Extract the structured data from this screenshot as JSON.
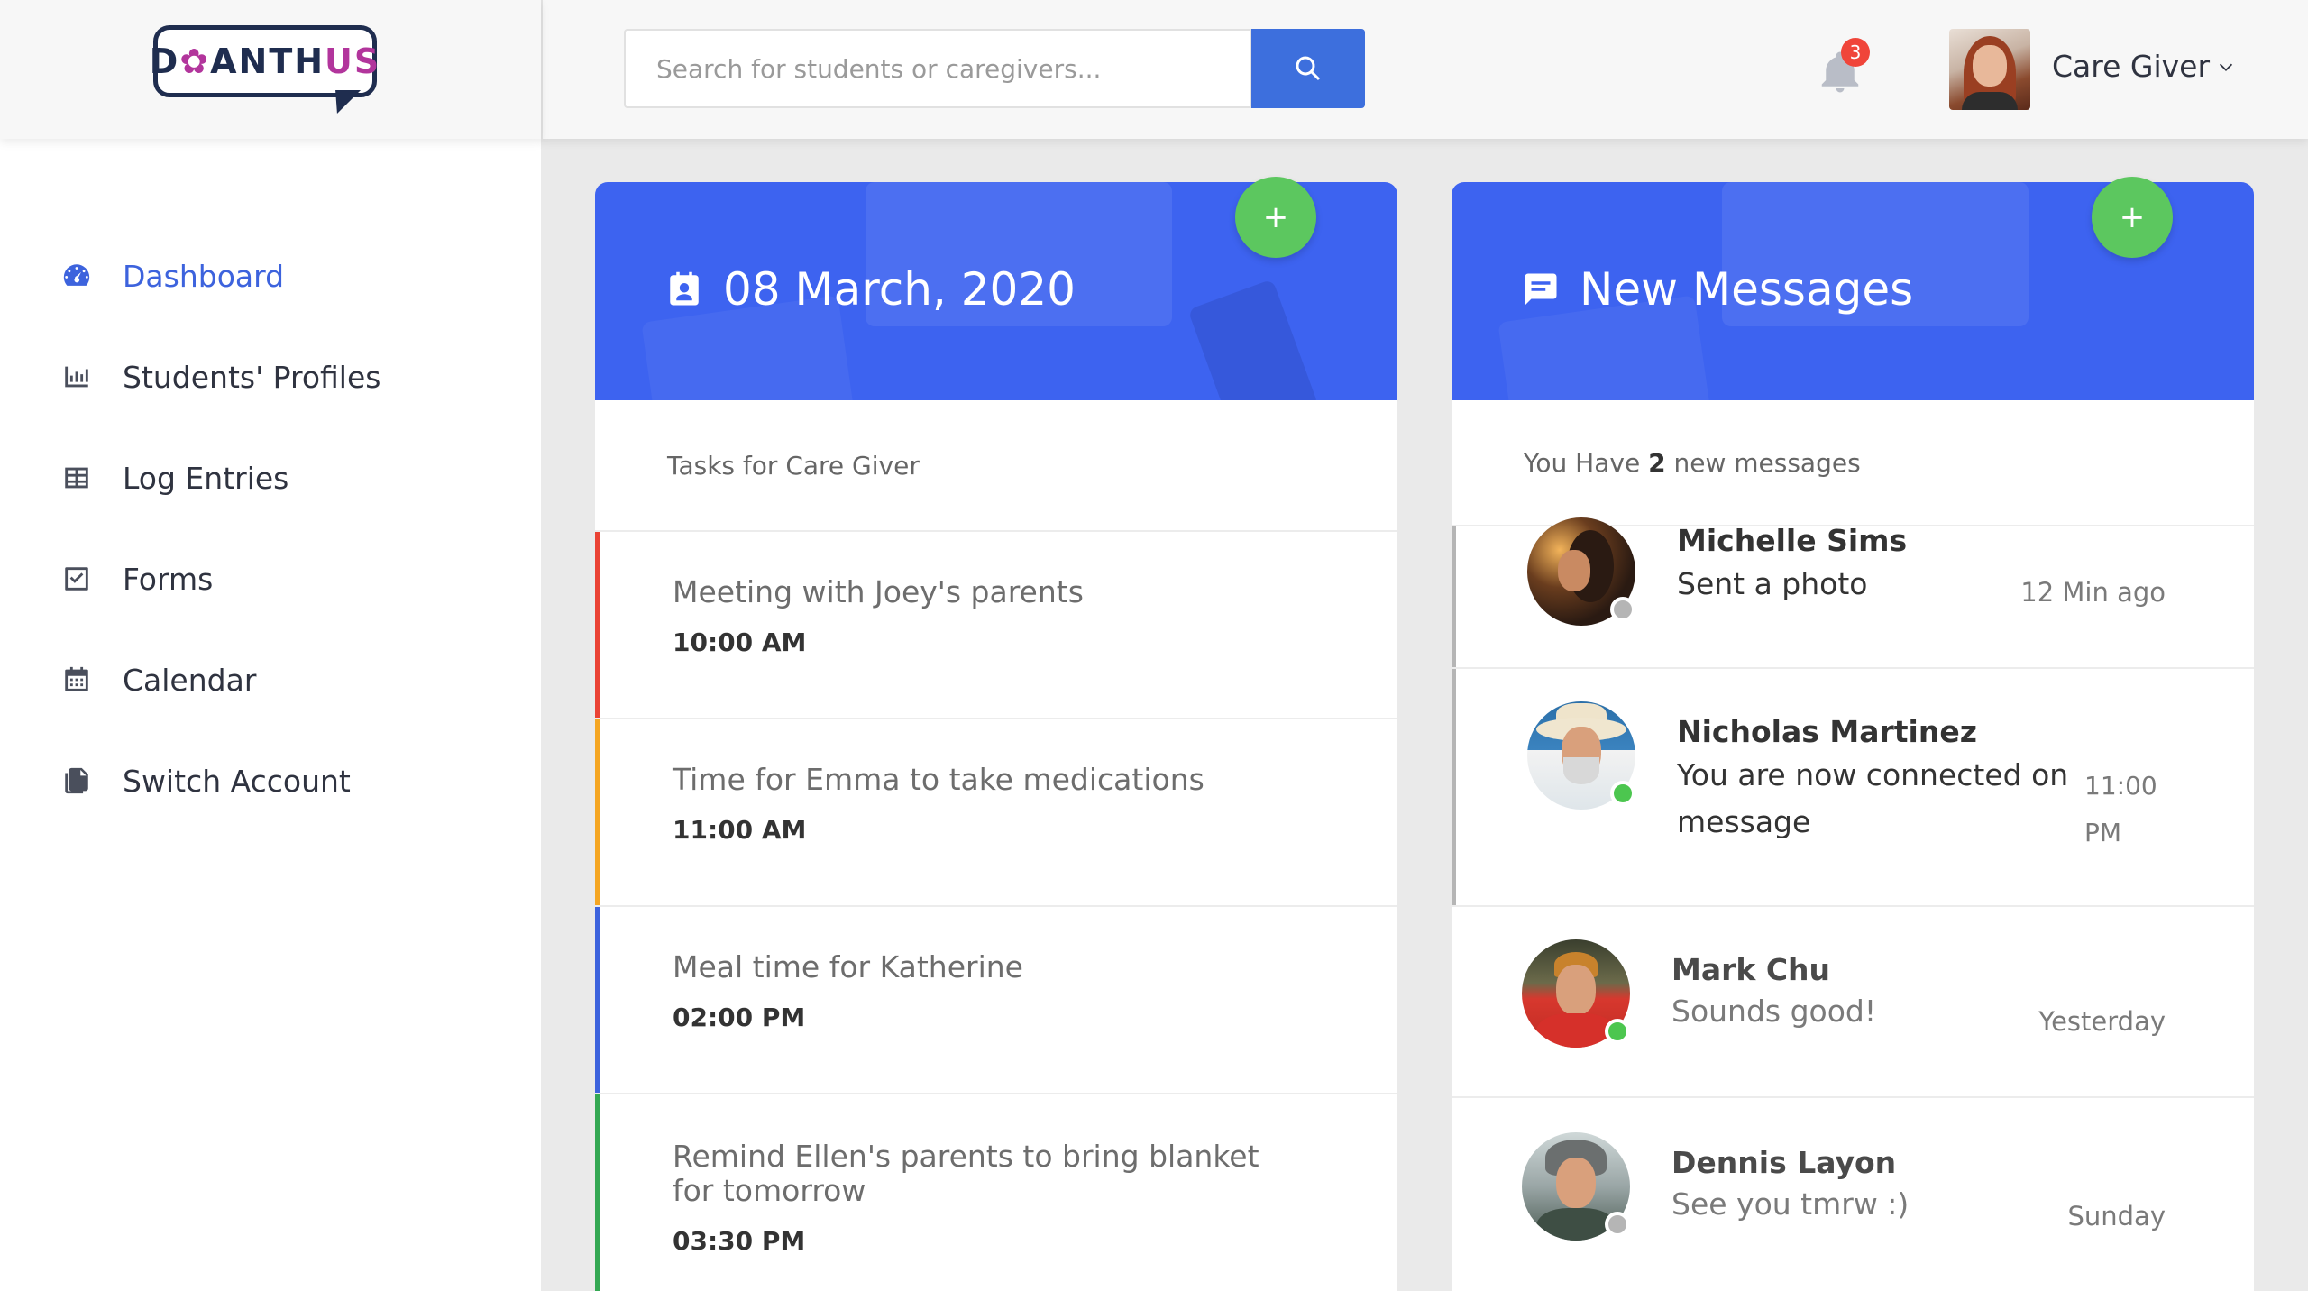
{
  "logo": {
    "part1": "D",
    "accent": "✿",
    "part2": "ANTH",
    "part3": "US"
  },
  "sidebar": {
    "items": [
      {
        "label": "Dashboard",
        "icon": "gauge-icon",
        "active": true
      },
      {
        "label": "Students' Profiles",
        "icon": "bar-chart-icon",
        "active": false
      },
      {
        "label": "Log Entries",
        "icon": "table-icon",
        "active": false
      },
      {
        "label": "Forms",
        "icon": "checkbox-icon",
        "active": false
      },
      {
        "label": "Calendar",
        "icon": "calendar-icon",
        "active": false
      },
      {
        "label": "Switch Account",
        "icon": "documents-icon",
        "active": false
      }
    ]
  },
  "topbar": {
    "search_placeholder": "Search for students or caregivers...",
    "notification_count": "3",
    "user_name": "Care Giver"
  },
  "tasks_card": {
    "title": "08 March, 2020",
    "add_label": "+",
    "subtitle": "Tasks for Care Giver",
    "tasks": [
      {
        "title": "Meeting with Joey's parents",
        "time": "10:00 AM",
        "color": "#ea4335"
      },
      {
        "title": "Time for Emma to take medications",
        "time": "11:00 AM",
        "color": "#f5a623"
      },
      {
        "title": "Meal time for Katherine",
        "time": "02:00 PM",
        "color": "#3d63dd"
      },
      {
        "title": "Remind Ellen's parents to bring blanket for tomorrow",
        "time": "03:30 PM",
        "color": "#34a853"
      }
    ]
  },
  "messages_card": {
    "title": "New Messages",
    "add_label": "+",
    "subtitle_prefix": "You Have",
    "subtitle_count": "2",
    "subtitle_suffix": "new messages",
    "messages": [
      {
        "name": "Michelle Sims",
        "text": "Sent a photo",
        "time": "12 Min ago",
        "online": false,
        "unread": true
      },
      {
        "name": "Nicholas Martinez",
        "text": "You are now connected on message",
        "time": "11:00 PM",
        "online": true,
        "unread": true
      },
      {
        "name": "Mark Chu",
        "text": "Sounds good!",
        "time": "Yesterday",
        "online": true,
        "unread": false
      },
      {
        "name": "Dennis Layon",
        "text": "See you tmrw :)",
        "time": "Sunday",
        "online": false,
        "unread": false
      }
    ]
  },
  "colors": {
    "accent": "#3d63dd",
    "header_blue": "#3d63f0",
    "fab_green": "#5cc75f",
    "online": "#4cc64f",
    "offline": "#b5b5b5"
  }
}
